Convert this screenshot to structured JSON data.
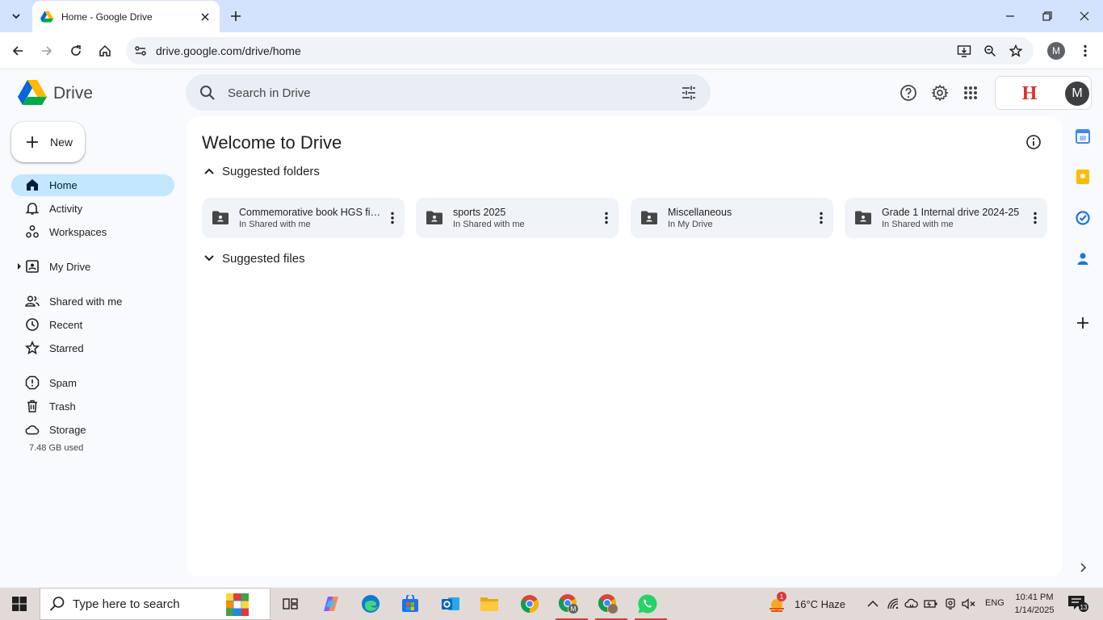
{
  "browser": {
    "tab_title": "Home - Google Drive",
    "url": "drive.google.com/drive/home",
    "profile_initial": "M"
  },
  "drive": {
    "app_name": "Drive",
    "search_placeholder": "Search in Drive",
    "avatar_initial": "M",
    "org_logo_letter": "H",
    "new_label": "New"
  },
  "sidebar": {
    "items": [
      {
        "label": "Home",
        "icon": "home-icon",
        "active": true
      },
      {
        "label": "Activity",
        "icon": "bell-icon"
      },
      {
        "label": "Workspaces",
        "icon": "workspaces-icon"
      },
      {
        "label": "My Drive",
        "icon": "my-drive-icon"
      },
      {
        "label": "Shared with me",
        "icon": "people-icon"
      },
      {
        "label": "Recent",
        "icon": "clock-icon"
      },
      {
        "label": "Starred",
        "icon": "star-icon"
      },
      {
        "label": "Spam",
        "icon": "spam-icon"
      },
      {
        "label": "Trash",
        "icon": "trash-icon"
      },
      {
        "label": "Storage",
        "icon": "cloud-icon"
      }
    ],
    "storage_used": "7.48 GB used"
  },
  "main": {
    "title": "Welcome to Drive",
    "suggested_folders_label": "Suggested folders",
    "suggested_files_label": "Suggested files",
    "folders": [
      {
        "name": "Commemorative book HGS fin...",
        "location": "In Shared with me"
      },
      {
        "name": "sports 2025",
        "location": "In Shared with me"
      },
      {
        "name": "Miscellaneous",
        "location": "In My Drive"
      },
      {
        "name": "Grade 1 Internal drive 2024-25",
        "location": "In Shared with me"
      }
    ]
  },
  "taskbar": {
    "search_placeholder": "Type here to search",
    "weather": "16°C  Haze",
    "weather_badge": "1",
    "language": "ENG",
    "time": "10:41 PM",
    "date": "1/14/2025",
    "notification_count": "13"
  },
  "colors": {
    "accent_active": "#c2e7ff",
    "tabstrip": "#d3e3fd",
    "taskbar": "#e2dad7"
  }
}
